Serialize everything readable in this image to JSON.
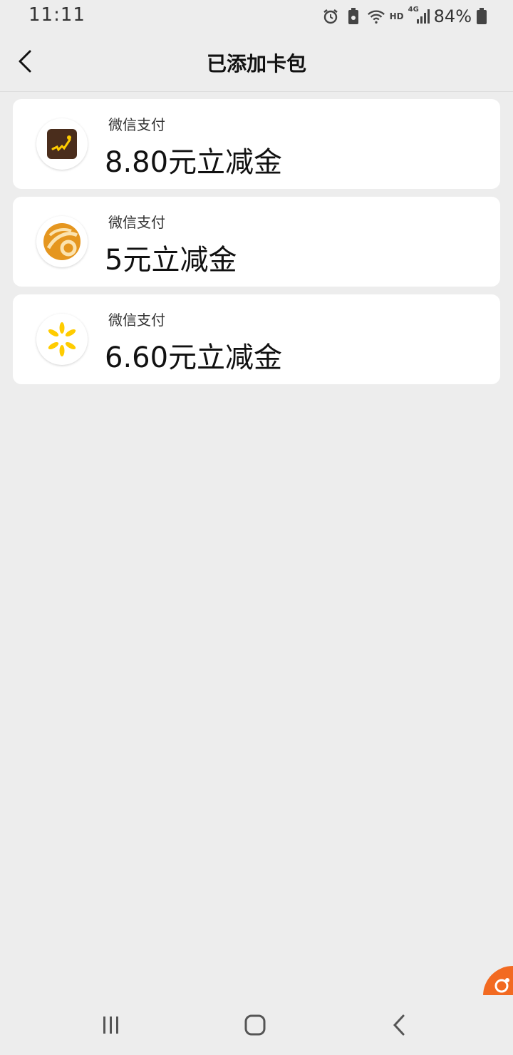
{
  "status_bar": {
    "time": "11:11",
    "network_label": "HD",
    "signal_label": "4G",
    "battery": "84%"
  },
  "header": {
    "title": "已添加卡包"
  },
  "cards": [
    {
      "source": "微信支付",
      "amount": "8.80元立减金",
      "logo": "brown-square-brand-logo"
    },
    {
      "source": "微信支付",
      "amount": "5元立减金",
      "logo": "orange-swirl-brand-logo"
    },
    {
      "source": "微信支付",
      "amount": "6.60元立减金",
      "logo": "yellow-spark-brand-logo"
    }
  ],
  "colors": {
    "background": "#ededed",
    "card": "#ffffff",
    "accent": "#f26a21",
    "logo_brown": "#4a2d1c",
    "logo_orange": "#e5961f",
    "logo_yellow": "#ffcc00"
  },
  "icons": {
    "back": "chevron-left-icon",
    "alarm": "alarm-icon",
    "battery_saver": "battery-saver-icon",
    "wifi": "wifi-icon",
    "signal": "signal-icon",
    "battery": "battery-icon",
    "nav_recent": "recent-apps-icon",
    "nav_home": "home-icon",
    "nav_back": "back-icon"
  }
}
